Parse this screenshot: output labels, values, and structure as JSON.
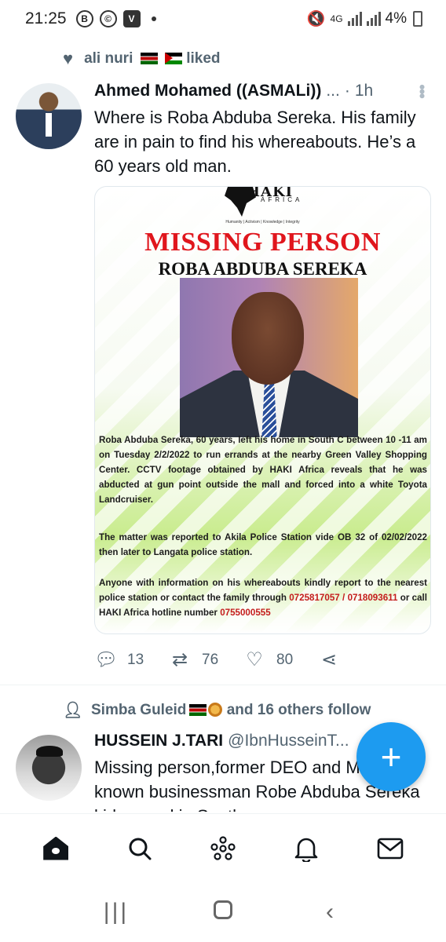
{
  "status_bar": {
    "time": "21:25",
    "left_icons": [
      "B",
      "©",
      "V"
    ],
    "right_label_network": "4G",
    "battery": "4%"
  },
  "tweet1": {
    "social_context_name": "ali nuri",
    "social_context_action": "liked",
    "author": "Ahmed Mohamed ((ASMALi))",
    "ellipsis": "...",
    "time": "1h",
    "text": "Where is Roba Abduba Sereka. His family are in pain to find his whereabouts. He’s a 60 years old man.",
    "poster": {
      "logo_word": "HAKI",
      "logo_subword": "AFRICA",
      "tagline": "Humanity | Activism | Knowledge | Integrity",
      "headline": "MISSING PERSON",
      "name": "ROBA ABDUBA SEREKA",
      "paragraph1": "Roba Abduba Sereka, 60 years, left his home in South C between 10 -11 am on Tuesday 2/2/2022 to run errands at the nearby Green  Valley Shopping Center. CCTV footage obtained by HAKI Africa reveals that he was abducted at gun point outside the mall and forced into a white Toyota Landcruiser.",
      "paragraph2": "The matter was reported to Akila Police Station vide OB 32 of 02/02/2022 then later to Langata police station.",
      "paragraph3_prefix": "Anyone with information on his whereabouts kindly report to the nearest police station or contact the family through",
      "phones": "0725817057 / 0718093611",
      "paragraph3_mid": "or call HAKI Africa hotline number",
      "hotline": "0755000555"
    },
    "replies": "13",
    "retweets": "76",
    "likes": "80"
  },
  "tweet2": {
    "social_context": "Simba Guleid",
    "social_context_suffix": "and 16 others follow",
    "author": "HUSSEIN J.TARI",
    "handle": "@IbnHusseinT...",
    "text": "Missing person,former DEO and Marsabit known businessman Robe Abduba Sereka kidnapped in South"
  },
  "fab_label": "+",
  "colors": {
    "accent": "#1d9bf0",
    "text": "#0f1419",
    "muted": "#536471",
    "poster_red": "#e0161d"
  },
  "icons": {
    "reply": "reply-icon",
    "retweet": "retweet-icon",
    "like": "heart-icon",
    "share": "share-icon",
    "home": "home-icon",
    "search": "search-icon",
    "spaces": "spaces-icon",
    "notifications": "bell-icon",
    "messages": "mail-icon"
  }
}
